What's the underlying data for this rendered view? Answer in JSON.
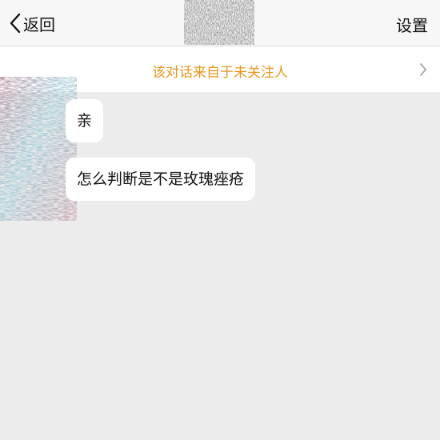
{
  "nav": {
    "back_label": "返回",
    "settings_label": "设置"
  },
  "notice": {
    "text": "该对话来自于未关注人",
    "color": "#e8961d"
  },
  "messages": [
    {
      "text": "亲"
    },
    {
      "text": "怎么判断是不是玫瑰痤疮"
    }
  ],
  "icons": {
    "back": "chevron-left-icon",
    "notice_arrow": "chevron-right-icon"
  },
  "colors": {
    "chat_background": "#ececec",
    "bubble": "#ffffff",
    "nav_background": "#f7f7f7"
  }
}
